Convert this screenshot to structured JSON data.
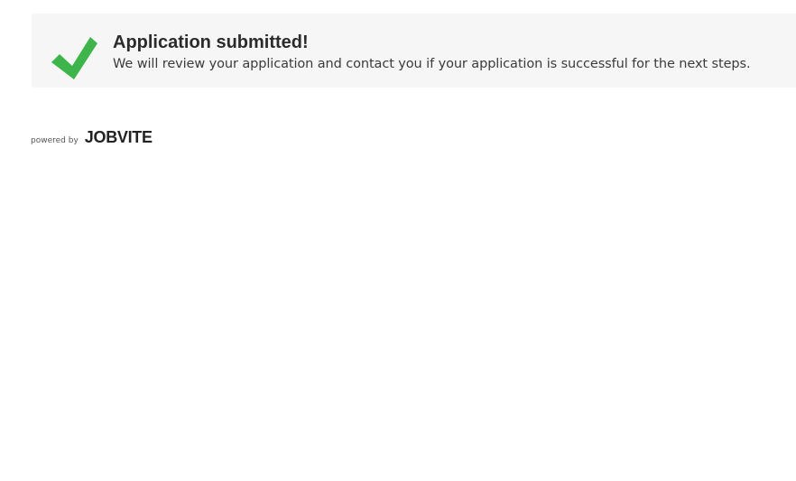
{
  "confirmation": {
    "title": "Application submitted!",
    "message": "We will review your application and contact you if your application is successful for the next steps.",
    "icon": "checkmark-icon",
    "icon_color": "#3db54a",
    "background_color": "#f6f6f6"
  },
  "footer": {
    "powered_by_label": "powered by",
    "brand_name": "JOBVITE",
    "brand_color": "#222222"
  }
}
